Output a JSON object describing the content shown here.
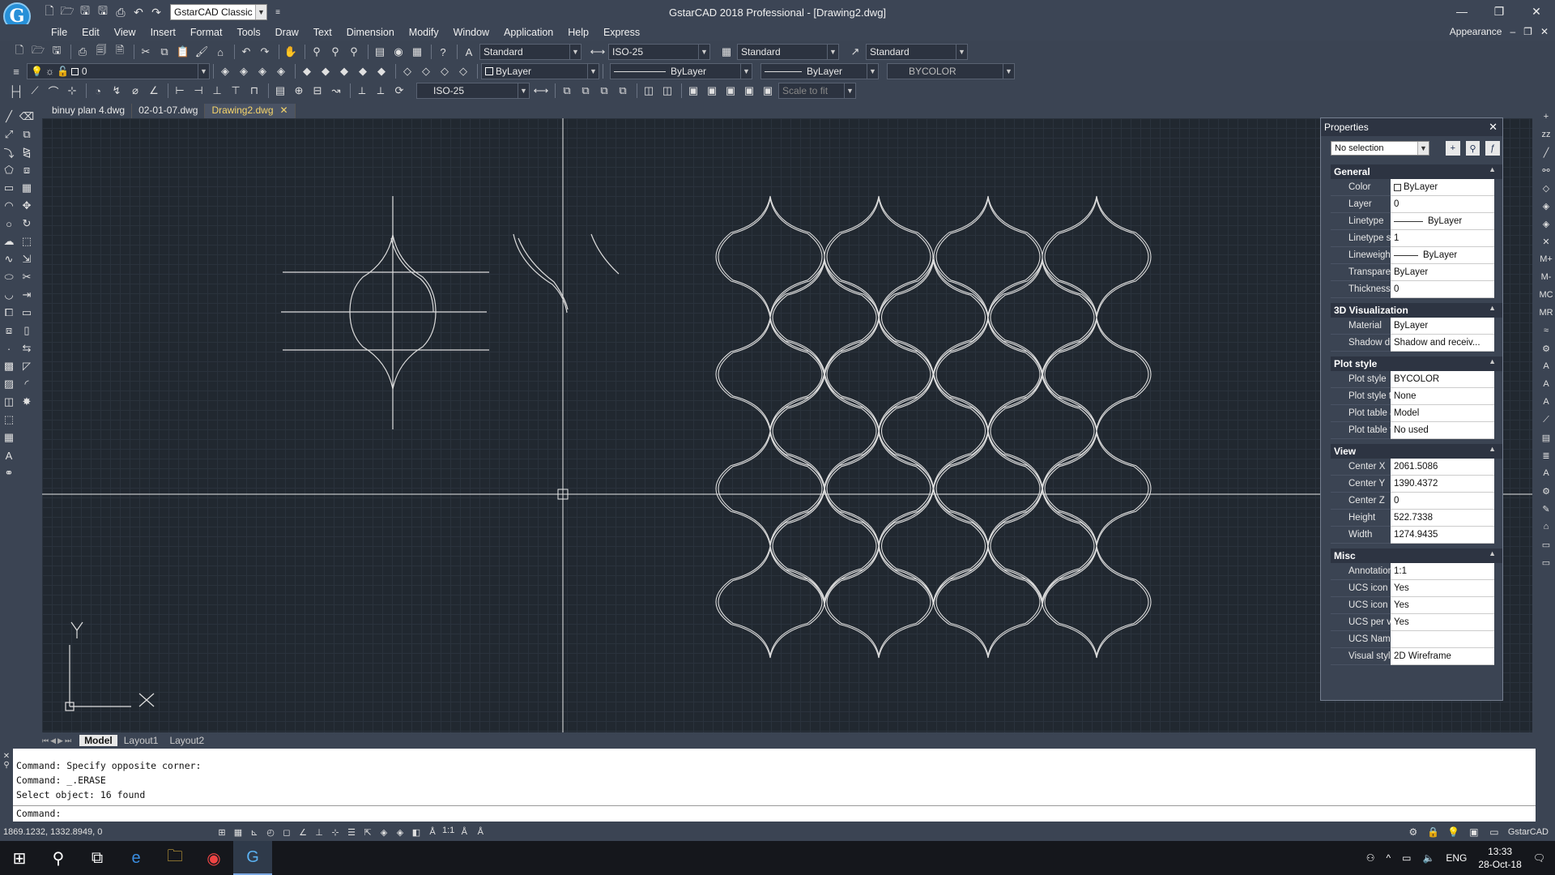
{
  "app": {
    "title": "GstarCAD 2018 Professional - [Drawing2.dwg]",
    "logo_letter": "G",
    "workspace": "GstarCAD Classic",
    "appearance_label": "Appearance"
  },
  "menu": [
    "File",
    "Edit",
    "View",
    "Insert",
    "Format",
    "Tools",
    "Draw",
    "Text",
    "Dimension",
    "Modify",
    "Window",
    "Application",
    "Help",
    "Express"
  ],
  "toolbar": {
    "text_style": "Standard",
    "dim_style": "ISO-25",
    "table_style": "Standard",
    "mleader_style": "Standard",
    "layer": "0",
    "color": "ByLayer",
    "linetype": "ByLayer",
    "lineweight": "ByLayer",
    "plot_style": "BYCOLOR",
    "dim_style_2": "ISO-25",
    "scale": "Scale to fit"
  },
  "doc_tabs": [
    {
      "label": "binuy plan 4.dwg",
      "active": false
    },
    {
      "label": "02-01-07.dwg",
      "active": false
    },
    {
      "label": "Drawing2.dwg",
      "active": true
    }
  ],
  "ucs": {
    "y_label": "Y",
    "x_label": "X"
  },
  "layout_tabs": [
    {
      "label": "Model",
      "active": true
    },
    {
      "label": "Layout1",
      "active": false
    },
    {
      "label": "Layout2",
      "active": false
    }
  ],
  "properties": {
    "title": "Properties",
    "selection": "No selection",
    "sections": [
      {
        "name": "General",
        "rows": [
          {
            "k": "Color",
            "v": "ByLayer"
          },
          {
            "k": "Layer",
            "v": "0"
          },
          {
            "k": "Linetype",
            "v": "ByLayer"
          },
          {
            "k": "Linetype sc",
            "v": "1"
          },
          {
            "k": "Lineweight",
            "v": "ByLayer"
          },
          {
            "k": "Transparency",
            "v": "ByLayer"
          },
          {
            "k": "Thickness",
            "v": "0"
          }
        ]
      },
      {
        "name": "3D Visualization",
        "rows": [
          {
            "k": "Material",
            "v": "ByLayer"
          },
          {
            "k": "Shadow dis...",
            "v": "Shadow and receiv..."
          }
        ]
      },
      {
        "name": "Plot style",
        "rows": [
          {
            "k": "Plot style",
            "v": "BYCOLOR"
          },
          {
            "k": "Plot style ta",
            "v": "None"
          },
          {
            "k": "Plot table at...",
            "v": "Model"
          },
          {
            "k": "Plot table type",
            "v": "No used"
          }
        ]
      },
      {
        "name": "View",
        "rows": [
          {
            "k": "Center X",
            "v": "2061.5086"
          },
          {
            "k": "Center Y",
            "v": "1390.4372"
          },
          {
            "k": "Center Z",
            "v": "0"
          },
          {
            "k": "Height",
            "v": "522.7338"
          },
          {
            "k": "Width",
            "v": "1274.9435"
          }
        ]
      },
      {
        "name": "Misc",
        "rows": [
          {
            "k": "Annotation ...",
            "v": "1:1"
          },
          {
            "k": "UCS icon On",
            "v": "Yes"
          },
          {
            "k": "UCS icon at...",
            "v": "Yes"
          },
          {
            "k": "UCS per vie...",
            "v": "Yes"
          },
          {
            "k": "UCS Name",
            "v": ""
          },
          {
            "k": "Visual styles",
            "v": "2D Wireframe"
          }
        ]
      }
    ]
  },
  "command": {
    "history": [
      "Command: Specify opposite corner:",
      "Command: _.ERASE",
      "Select object:  16 found"
    ],
    "prompt": "Command:"
  },
  "status": {
    "coords": "1869.1232, 1332.8949, 0",
    "scale": "1:1",
    "brand": "GstarCAD"
  },
  "taskbar": {
    "lang": "ENG",
    "time": "13:33",
    "date": "28-Oct-18"
  }
}
